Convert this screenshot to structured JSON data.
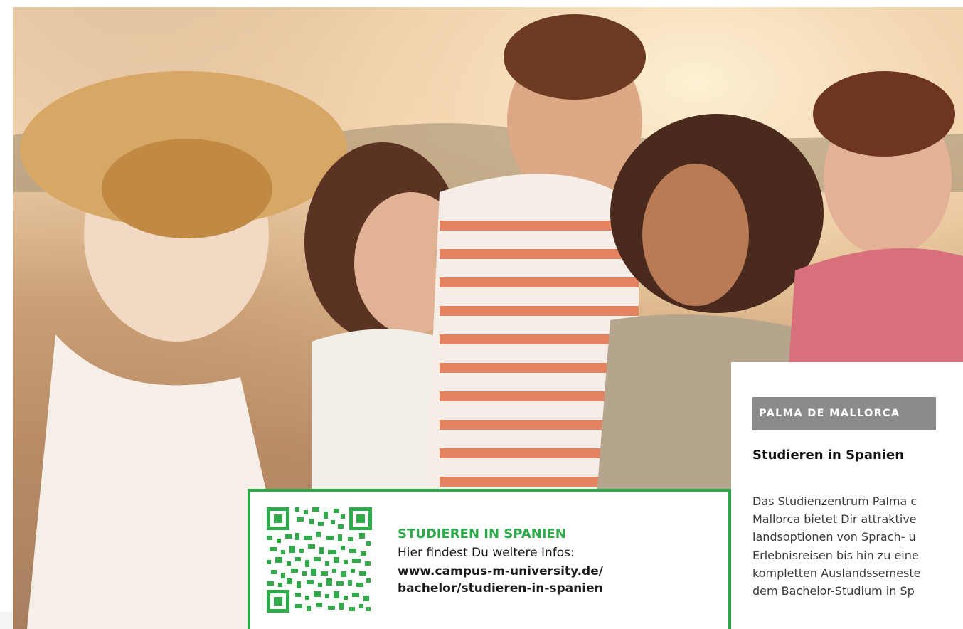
{
  "hero": {
    "image": "group-of-five-laughing-students-beach-sunset-photo"
  },
  "info_card": {
    "location_badge": "PALMA DE MALLORCA",
    "heading": "Studieren in Spanien",
    "body": "Das Studienzentrum Palma c\nMallorca bietet Dir attraktive\nlandsoptionen von Sprach- u\nErlebnisreisen bis hin zu eine\nkompletten Auslandssemeste\ndem Bachelor-Studium in Sp"
  },
  "qr_box": {
    "qr_icon": "qr-code-icon",
    "title": "STUDIEREN IN SPANIEN",
    "line": "Hier findest Du weitere Infos:",
    "url": "www.campus-m-university.de/\nbachelor/studieren-in-spanien"
  },
  "colors": {
    "accent_green": "#2eaa4a",
    "badge_gray": "#8b8b8b"
  }
}
